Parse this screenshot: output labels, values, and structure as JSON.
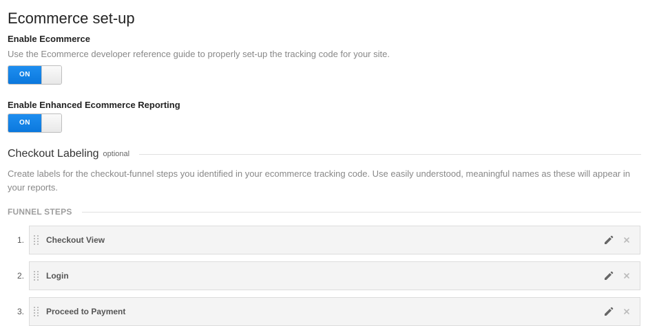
{
  "page_title": "Ecommerce set-up",
  "enable_ecommerce": {
    "label": "Enable Ecommerce",
    "help": "Use the Ecommerce developer reference guide to properly set-up the tracking code for your site.",
    "toggle_label": "ON"
  },
  "enable_enhanced": {
    "label": "Enable Enhanced Ecommerce Reporting",
    "toggle_label": "ON"
  },
  "checkout_labeling": {
    "title": "Checkout Labeling",
    "optional": "optional",
    "description": "Create labels for the checkout-funnel steps you identified in your ecommerce tracking code. Use easily understood, meaningful names as these will appear in your reports."
  },
  "funnel_steps": {
    "title": "FUNNEL STEPS",
    "steps": [
      {
        "number": "1.",
        "label": "Checkout View"
      },
      {
        "number": "2.",
        "label": "Login"
      },
      {
        "number": "3.",
        "label": "Proceed to Payment"
      }
    ]
  },
  "colors": {
    "toggle_on": "#1384ea",
    "step_background": "#f4f4f4",
    "muted_text": "#888888"
  },
  "icons": {
    "drag": "drag-handle-icon",
    "edit": "pencil-icon",
    "remove": "close-icon"
  }
}
